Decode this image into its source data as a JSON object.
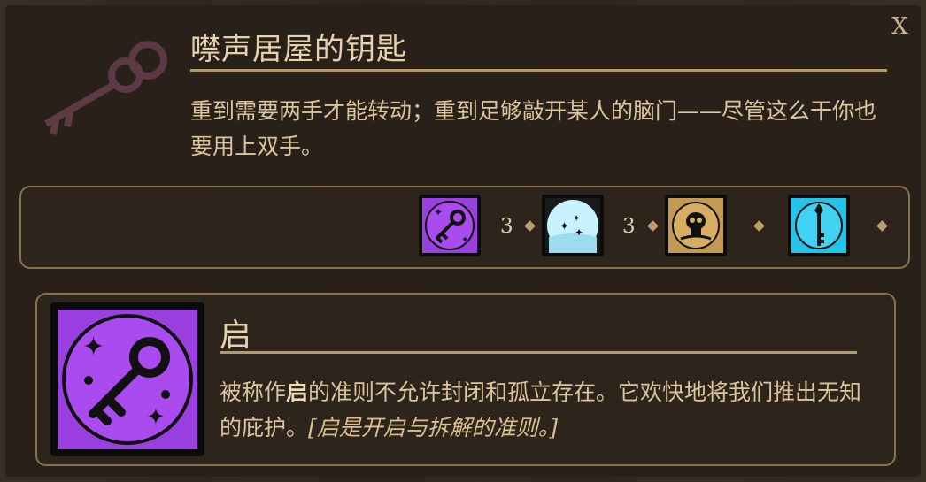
{
  "window": {
    "close_label": "X",
    "title": "噤声居屋的钥匙",
    "description": "重到需要两手才能转动；重到足够敲开某人的脑门——尽管这么干你也要用上双手。"
  },
  "aspects": [
    {
      "icon": "lantern-key-icon",
      "count": "3",
      "color": "#9a3fe0"
    },
    {
      "icon": "moon-stars-icon",
      "count": "3",
      "color": "#bfeeff"
    },
    {
      "icon": "skull-icon",
      "count": "",
      "color": "#c49a52"
    },
    {
      "icon": "key-icon",
      "count": "",
      "color": "#22c4ea"
    }
  ],
  "detail": {
    "icon": "lantern-key-icon",
    "name": "启",
    "text_part1": "被称作",
    "text_bold": "启",
    "text_part2": "的准则不允许封闭和孤立存在。它欢快地将我们推出无知的庇护。",
    "text_italic": "[启是开启与拆解的准则。]"
  },
  "colors": {
    "accent_rule": "#b79a6c",
    "text": "#dcc49d",
    "lantern": "#9a3fe0"
  }
}
